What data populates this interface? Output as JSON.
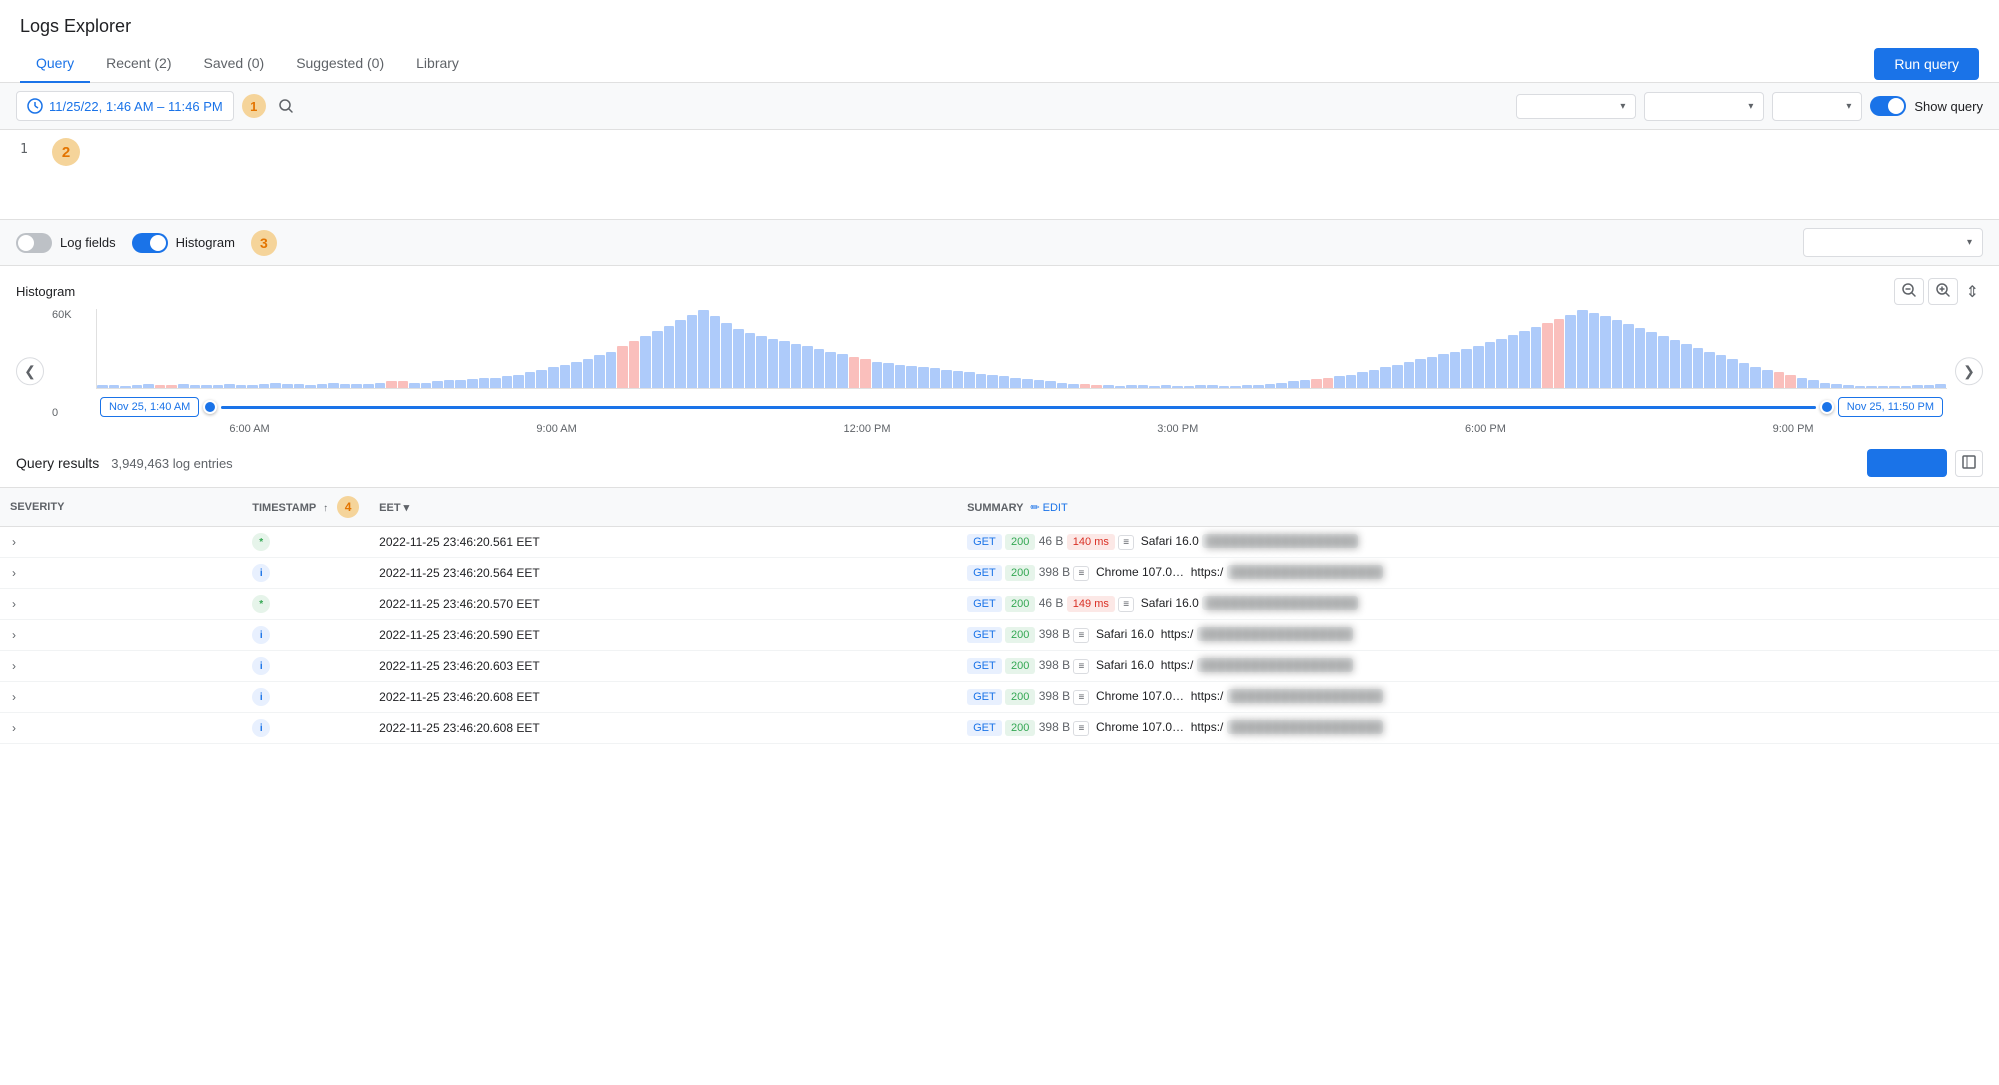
{
  "app": {
    "title": "Logs Explorer"
  },
  "tabs": [
    {
      "id": "query",
      "label": "Query",
      "active": true
    },
    {
      "id": "recent",
      "label": "Recent (2)",
      "active": false
    },
    {
      "id": "saved",
      "label": "Saved (0)",
      "active": false
    },
    {
      "id": "suggested",
      "label": "Suggested (0)",
      "active": false
    },
    {
      "id": "library",
      "label": "Library",
      "active": false
    }
  ],
  "toolbar": {
    "run_query_label": "Run query",
    "time_range": "11/25/22, 1:46 AM – 11:46 PM",
    "show_query_label": "Show query",
    "dropdown1_placeholder": "",
    "dropdown2_placeholder": "",
    "dropdown3_placeholder": ""
  },
  "query_editor": {
    "line_number": "1"
  },
  "controls": {
    "log_fields_label": "Log fields",
    "histogram_label": "Histogram",
    "filter_placeholder": ""
  },
  "histogram": {
    "title": "Histogram",
    "y_max": "60K",
    "y_min": "0",
    "start_label": "Nov 25, 1:40 AM",
    "end_label": "Nov 25, 11:50 PM",
    "time_labels": [
      "6:00 AM",
      "9:00 AM",
      "12:00 PM",
      "3:00 PM",
      "6:00 PM",
      "9:00 PM"
    ]
  },
  "results": {
    "title": "Query results",
    "count": "3,949,463 log entries",
    "columns": [
      "SEVERITY",
      "TIMESTAMP",
      "EET",
      "SUMMARY"
    ],
    "rows": [
      {
        "severity_type": "notice",
        "severity_char": "*",
        "timestamp": "2022-11-25 23:46:20.561 EET",
        "method": "GET",
        "status": "200",
        "size": "46 B",
        "latency": "140 ms",
        "latency_type": "red",
        "agent": "Safari 16.0",
        "url": ""
      },
      {
        "severity_type": "info",
        "severity_char": "i",
        "timestamp": "2022-11-25 23:46:20.564 EET",
        "method": "GET",
        "status": "200",
        "size": "398 B",
        "latency": "",
        "latency_type": "",
        "agent": "Chrome 107.0…",
        "url": "https:/"
      },
      {
        "severity_type": "notice",
        "severity_char": "*",
        "timestamp": "2022-11-25 23:46:20.570 EET",
        "method": "GET",
        "status": "200",
        "size": "46 B",
        "latency": "149 ms",
        "latency_type": "red",
        "agent": "Safari 16.0",
        "url": ""
      },
      {
        "severity_type": "info",
        "severity_char": "i",
        "timestamp": "2022-11-25 23:46:20.590 EET",
        "method": "GET",
        "status": "200",
        "size": "398 B",
        "latency": "",
        "latency_type": "",
        "agent": "Safari 16.0",
        "url": "https:/"
      },
      {
        "severity_type": "info",
        "severity_char": "i",
        "timestamp": "2022-11-25 23:46:20.603 EET",
        "method": "GET",
        "status": "200",
        "size": "398 B",
        "latency": "",
        "latency_type": "",
        "agent": "Safari 16.0",
        "url": "https:/"
      },
      {
        "severity_type": "info",
        "severity_char": "i",
        "timestamp": "2022-11-25 23:46:20.608 EET",
        "method": "GET",
        "status": "200",
        "size": "398 B",
        "latency": "",
        "latency_type": "",
        "agent": "Chrome 107.0…",
        "url": "https:/"
      },
      {
        "severity_type": "info",
        "severity_char": "i",
        "timestamp": "2022-11-25 23:46:20.608 EET",
        "method": "GET",
        "status": "200",
        "size": "398 B",
        "latency": "",
        "latency_type": "",
        "agent": "Chrome 107.0…",
        "url": "https:/"
      }
    ]
  },
  "badges": {
    "b1": "1",
    "b2": "2",
    "b3": "3",
    "b4": "4"
  },
  "icons": {
    "clock": "🕐",
    "search": "🔍",
    "chevron_down": "▾",
    "chevron_left": "❮",
    "chevron_right": "❯",
    "zoom_out": "🔍−",
    "zoom_in": "🔍+",
    "expand": "⤢",
    "edit": "✏",
    "sort_asc": "↑",
    "filter": "≡"
  }
}
